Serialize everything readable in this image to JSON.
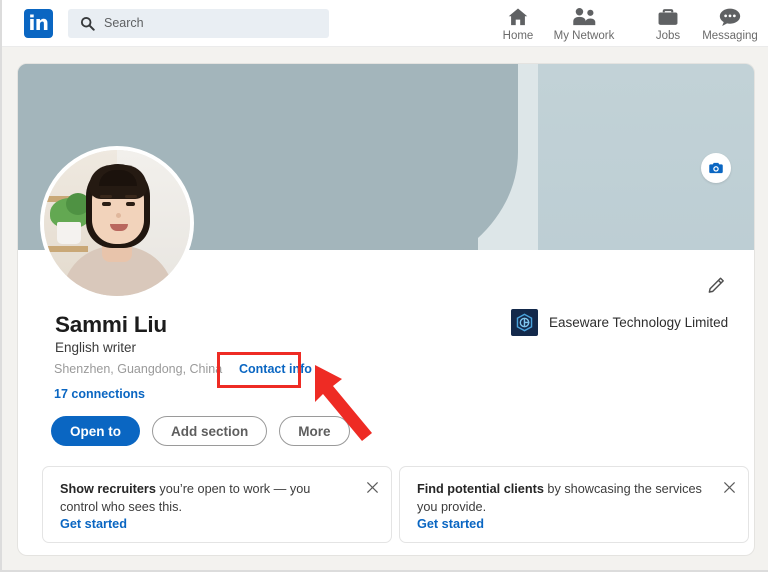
{
  "header": {
    "logo_icon": "linkedin-logo-icon",
    "logo_text": "in",
    "search": {
      "icon": "search-icon",
      "placeholder": "Search",
      "value": ""
    },
    "nav_items": [
      {
        "id": "home",
        "label": "Home",
        "icon": "home-icon"
      },
      {
        "id": "network",
        "label": "My Network",
        "icon": "people-icon"
      },
      {
        "id": "jobs",
        "label": "Jobs",
        "icon": "briefcase-icon"
      },
      {
        "id": "messaging",
        "label": "Messaging",
        "icon": "message-bubble-icon"
      }
    ]
  },
  "profile": {
    "cover": {
      "camera_button_icon": "camera-icon",
      "colors": {
        "dark": "#a3b5bb",
        "light_strip": "#dde6e8",
        "right": "#c2d2d7"
      }
    },
    "avatar_icon": "profile-photo",
    "edit_icon": "pencil-edit-icon",
    "name": "Sammi Liu",
    "headline": "English writer",
    "location": "Shenzhen, Guangdong, China",
    "contact_info_label": "Contact info",
    "connections_label": "17 connections",
    "company": {
      "logo_icon": "easeware-logo-icon",
      "name": "Easeware Technology Limited"
    },
    "buttons": [
      {
        "id": "open-to",
        "label": "Open to",
        "style": "primary"
      },
      {
        "id": "add-section",
        "label": "Add section",
        "style": "outline"
      },
      {
        "id": "more",
        "label": "More",
        "style": "outline"
      }
    ]
  },
  "promos": [
    {
      "id": "open-to-work",
      "bold_text": "Show recruiters",
      "rest_text": " you’re open to work — you control who sees this.",
      "link_label": "Get started",
      "close_icon": "close-icon"
    },
    {
      "id": "find-clients",
      "bold_text": "Find potential clients",
      "rest_text": " by showcasing the services you provide.",
      "link_label": "Get started",
      "close_icon": "close-icon"
    }
  ],
  "annotations": {
    "highlight_color": "#ee2b24",
    "box_target": "Contact info",
    "arrow_icon": "red-arrow-icon"
  },
  "colors": {
    "brand_blue": "#0a66c2",
    "page_background": "#f3f2ef",
    "card_background": "#ffffff"
  }
}
